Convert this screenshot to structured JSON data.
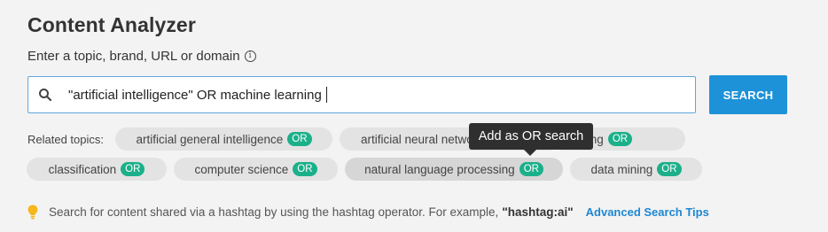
{
  "page": {
    "title": "Content Analyzer"
  },
  "search": {
    "prompt": "Enter a topic, brand, URL or domain",
    "info_icon": "info-icon",
    "value": "\"artificial intelligence\" OR machine learning",
    "button_label": "SEARCH"
  },
  "related": {
    "label": "Related topics:",
    "badge": "OR",
    "chips": [
      {
        "label": "artificial general intelligence"
      },
      {
        "label": "artificial neural networks"
      },
      {
        "label": "deep learning"
      },
      {
        "label": "classification"
      },
      {
        "label": "computer science"
      },
      {
        "label": "natural language processing"
      },
      {
        "label": "data mining"
      }
    ]
  },
  "tooltip": {
    "text": "Add as OR search"
  },
  "tip": {
    "icon": "lightbulb-icon",
    "text": "Search for content shared via a hashtag by using the hashtag operator. For example,",
    "example": "\"hashtag:ai\"",
    "link": "Advanced Search Tips"
  },
  "colors": {
    "accent": "#1e92d8",
    "or_badge": "#1bb08a",
    "link": "#1e87d3"
  }
}
